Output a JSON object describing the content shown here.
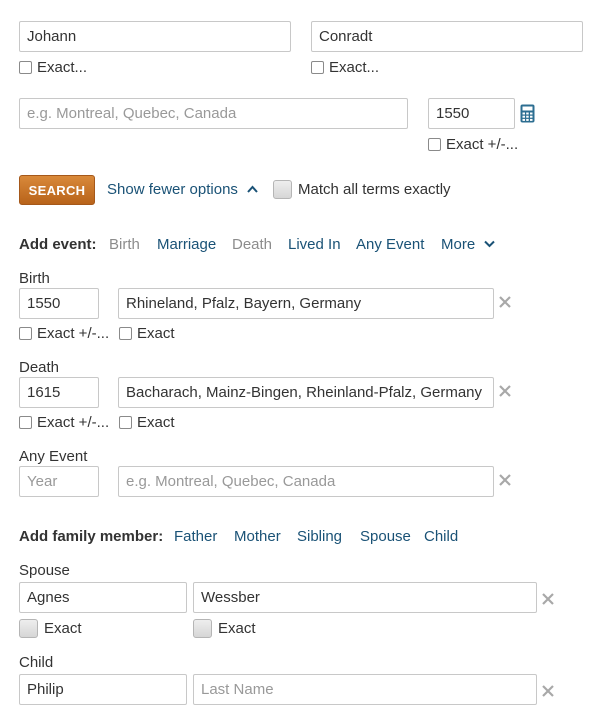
{
  "name": {
    "first": {
      "value": "Johann",
      "exact_label": "Exact..."
    },
    "last": {
      "value": "Conradt",
      "exact_label": "Exact..."
    }
  },
  "place": {
    "value": "",
    "placeholder": "e.g. Montreal, Quebec, Canada"
  },
  "year": {
    "value": "1550",
    "exact_label": "Exact +/-..."
  },
  "icons": {
    "calculator": "calculator-icon",
    "remove": "close-icon",
    "chevron_up": "chevron-up-icon",
    "chevron_down": "chevron-down-icon"
  },
  "colors": {
    "link": "#1a5276",
    "search_button": "#c8742a",
    "muted": "#8c8c8c"
  },
  "actions": {
    "search_label": "SEARCH",
    "fewer_options_label": "Show fewer options",
    "match_all_label": "Match all terms exactly"
  },
  "events": {
    "add_label": "Add event:",
    "options": [
      "Birth",
      "Marriage",
      "Death",
      "Lived In",
      "Any Event",
      "More"
    ],
    "birth": {
      "title": "Birth",
      "year": "1550",
      "place": "Rhineland, Pfalz, Bayern, Germany",
      "exact_year_label": "Exact +/-...",
      "exact_place_label": "Exact"
    },
    "death": {
      "title": "Death",
      "year": "1615",
      "place": "Bacharach, Mainz-Bingen, Rheinland-Pfalz, Germany",
      "exact_year_label": "Exact +/-...",
      "exact_place_label": "Exact"
    },
    "any": {
      "title": "Any Event",
      "year": "",
      "year_placeholder": "Year",
      "place": "",
      "place_placeholder": "e.g. Montreal, Quebec, Canada"
    }
  },
  "family": {
    "add_label": "Add family member:",
    "options": [
      "Father",
      "Mother",
      "Sibling",
      "Spouse",
      "Child"
    ],
    "spouse": {
      "title": "Spouse",
      "first": "Agnes",
      "last": "Wessber",
      "exact_first_label": "Exact",
      "exact_last_label": "Exact"
    },
    "child": {
      "title": "Child",
      "first": "Philip",
      "last": "",
      "last_placeholder": "Last Name"
    }
  }
}
